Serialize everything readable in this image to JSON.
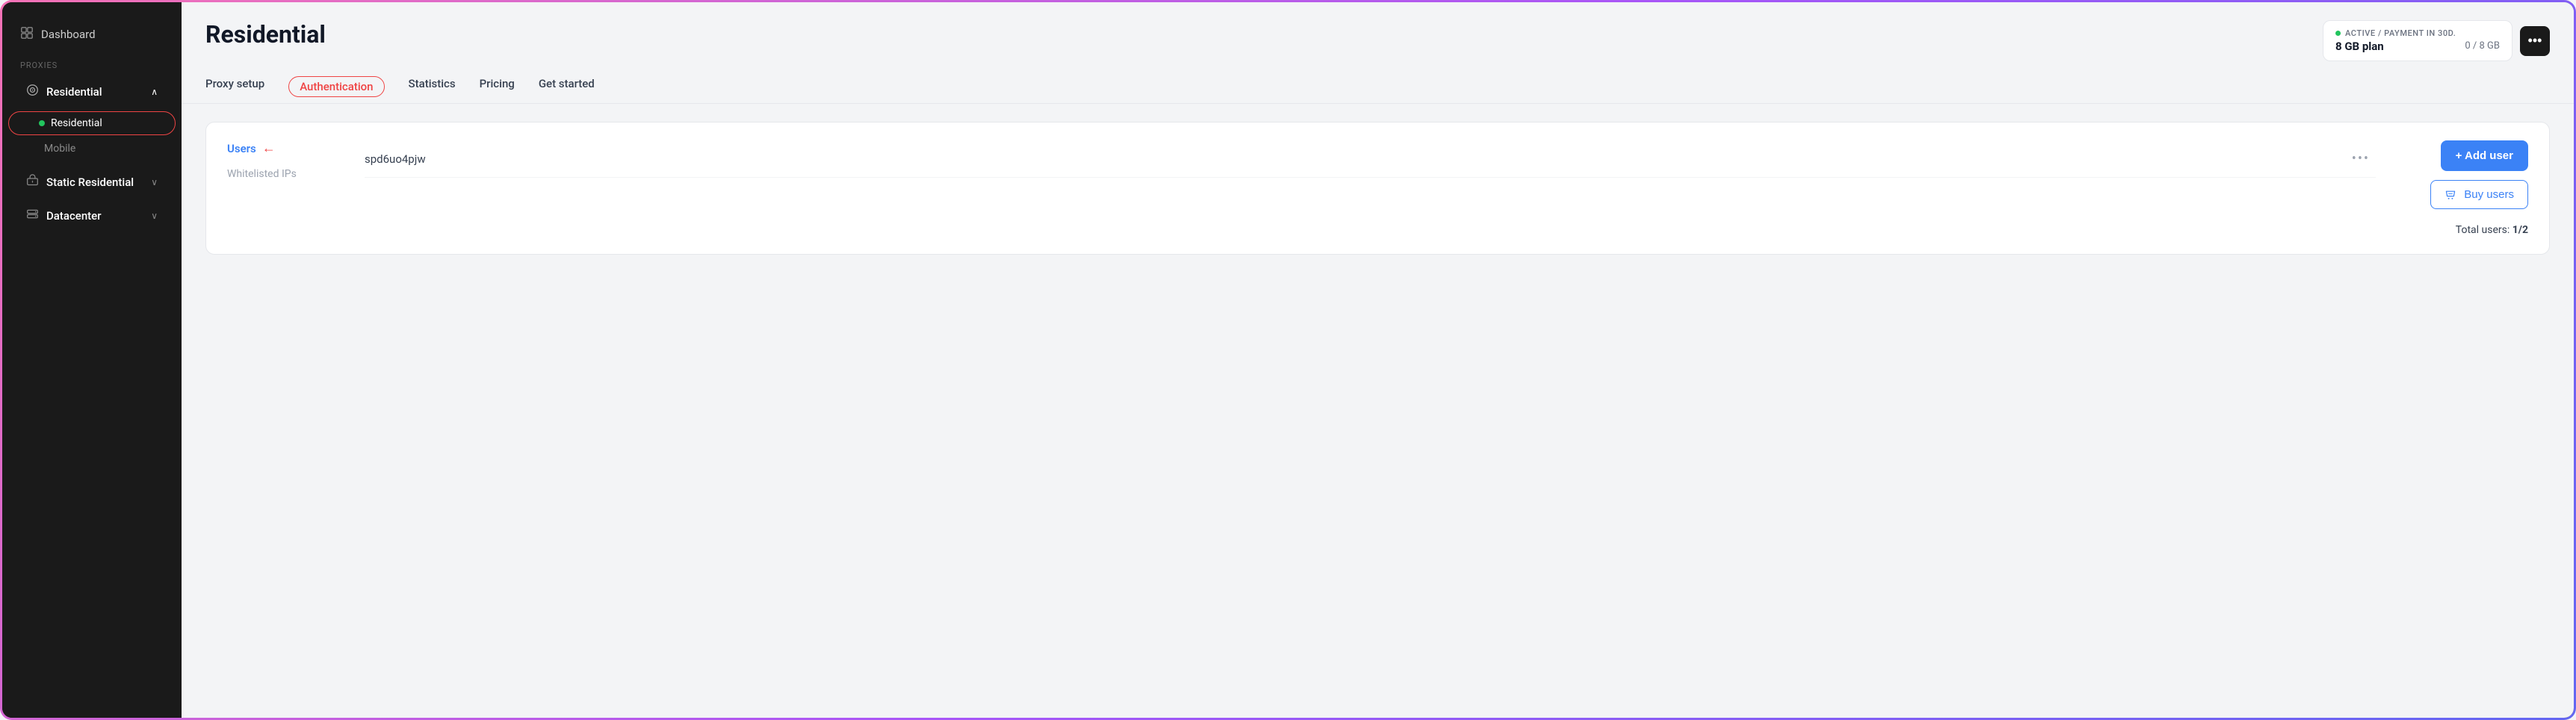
{
  "sidebar": {
    "dashboard_label": "Dashboard",
    "proxies_section": "PROXIES",
    "residential_group": {
      "label": "Residential",
      "expanded": true,
      "sub_items": [
        {
          "label": "Residential",
          "active": true,
          "has_dot": true
        },
        {
          "label": "Mobile",
          "active": false
        }
      ]
    },
    "static_residential_group": {
      "label": "Static Residential",
      "expanded": false
    },
    "datacenter_group": {
      "label": "Datacenter",
      "expanded": false
    }
  },
  "page": {
    "title": "Residential"
  },
  "plan_badge": {
    "status_text": "ACTIVE / PAYMENT IN 30D.",
    "plan_name": "8 GB plan",
    "usage": "0 / 8 GB"
  },
  "tabs": [
    {
      "label": "Proxy setup",
      "active": false
    },
    {
      "label": "Authentication",
      "active": true
    },
    {
      "label": "Statistics",
      "active": false
    },
    {
      "label": "Pricing",
      "active": false
    },
    {
      "label": "Get started",
      "active": false
    }
  ],
  "auth": {
    "users_label": "Users",
    "whitelisted_label": "Whitelisted IPs",
    "user_entry": "spd6uo4pjw",
    "add_user_button": "+ Add user",
    "buy_users_button": "Buy users",
    "total_users_prefix": "Total users: ",
    "total_users_value": "1/2"
  },
  "more_button_label": "•••"
}
